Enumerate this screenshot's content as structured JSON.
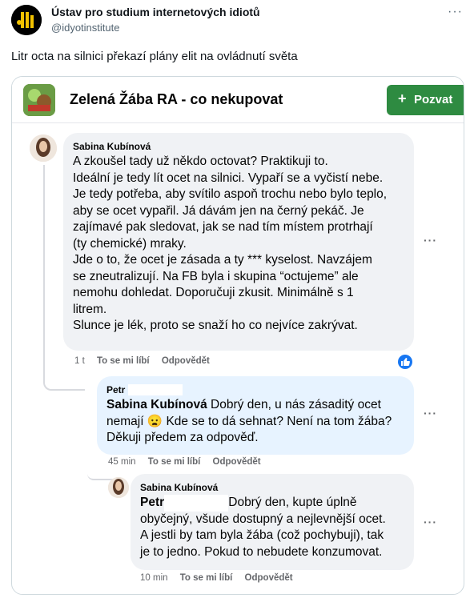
{
  "tweet": {
    "author_name": "Ústav pro studium internetových idiotů",
    "author_handle": "@idyotinstitute",
    "more_label": "···",
    "text": "Litr octa na silnici překazí plány elit na ovládnutí světa"
  },
  "facebook": {
    "group_title": "Zelená Žába RA - co nekupovat",
    "invite_plus": "+",
    "invite_label": "Pozvat",
    "comments": [
      {
        "author": "Sabina Kubínová",
        "lines": [
          "A zkoušel tady už někdo octovat? Praktikuji to.",
          "Ideální je tedy lít ocet na silnici. Vypaří se a vyčistí nebe.",
          "Je tedy potřeba, aby svítilo aspoň trochu nebo bylo teplo,",
          "aby se ocet vypařil. Já dávám jen na černý pekáč. Je",
          "zajímavé pak sledovat, jak se nad tím místem protrhají",
          "(ty chemické) mraky.",
          "Jde o to, že ocet je zásada a ty *** kyselost. Navzájem",
          "se zneutralizují. Na FB byla i skupina “octujeme” ale",
          "nemohu dohledat. Doporučuji zkusit. Minimálně s 1",
          "litrem.",
          "Slunce je lék, proto se snaží ho co nejvíce zakrývat."
        ],
        "time": "1 t",
        "like": "To se mi líbí",
        "reply": "Odpovědět",
        "more": "···"
      },
      {
        "author": "Petr",
        "mention": "Sabina Kubínová",
        "line1_rest": " Dobrý den, u nás zásaditý ocet",
        "line2_a": "nemají ",
        "emoji": "😦",
        "line2_b": " Kde se to dá sehnat? Není na tom žába?",
        "line3": "Děkuji předem za odpověď.",
        "time": "45 min",
        "like": "To se mi líbí",
        "reply": "Odpovědět",
        "more": "···"
      },
      {
        "author": "Sabina Kubínová",
        "mention": "Petr",
        "line1_rest": "Dobrý den, kupte úplně",
        "line2": "obyčejný, všude dostupný a nejlevnější ocet.",
        "line3": "A jestli by tam byla žába (což pochybuji), tak",
        "line4": "je to jedno. Pokud to nebudete konzumovat.",
        "time": "10 min",
        "like": "To se mi líbí",
        "reply": "Odpovědět",
        "more": "···"
      }
    ]
  },
  "colors": {
    "bubble_grey": "#f0f2f5",
    "bubble_blue": "#e7f3ff",
    "invite_green": "#2e8b41",
    "like_blue": "#1877f2"
  }
}
